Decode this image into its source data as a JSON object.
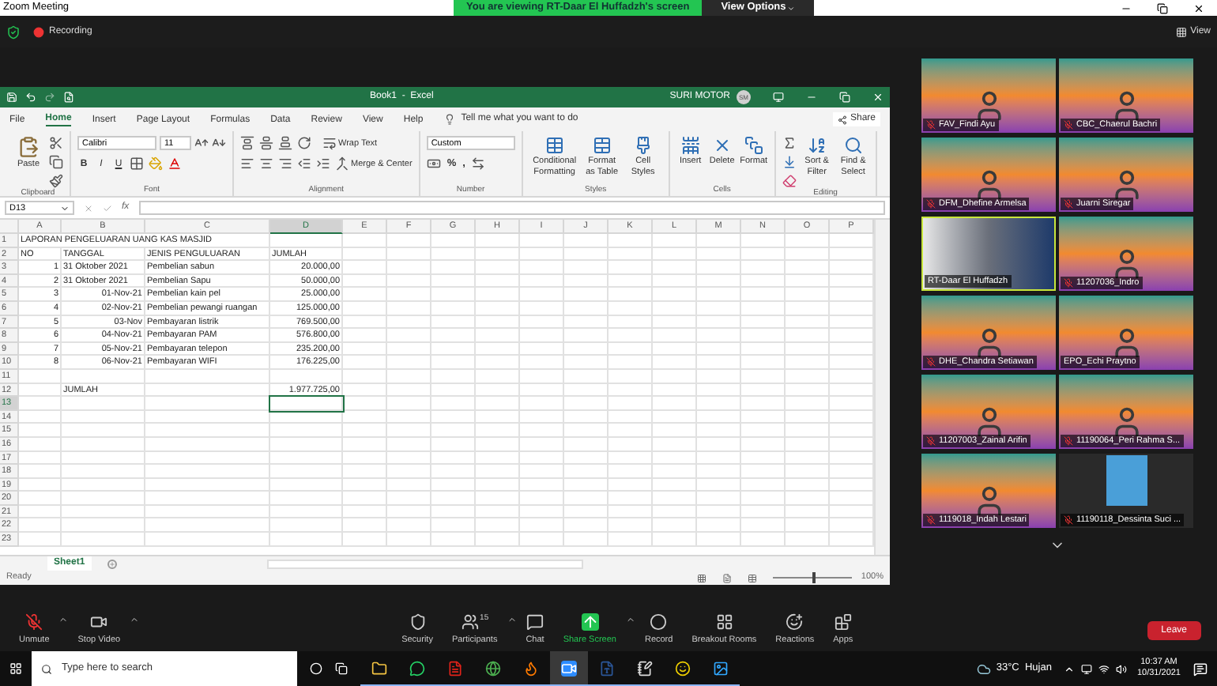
{
  "window": {
    "title": "Zoom Meeting",
    "screen_banner": "You are viewing RT-Daar El Huffadzh's screen",
    "view_options": "View Options"
  },
  "meeting_bar": {
    "recording": "Recording",
    "view": "View"
  },
  "excel": {
    "title": "Book1  -  Excel",
    "user": "SURI MOTOR",
    "user_initials": "SM",
    "tabs": [
      {
        "label": "File",
        "selected": false
      },
      {
        "label": "Home",
        "selected": true
      },
      {
        "label": "Insert",
        "selected": false
      },
      {
        "label": "Page Layout",
        "selected": false
      },
      {
        "label": "Formulas",
        "selected": false
      },
      {
        "label": "Data",
        "selected": false
      },
      {
        "label": "Review",
        "selected": false
      },
      {
        "label": "View",
        "selected": false
      },
      {
        "label": "Help",
        "selected": false
      }
    ],
    "tell_me": "Tell me what you want to do",
    "share": "Share",
    "ribbon_groups": [
      {
        "kind": "clipboard",
        "label": "Clipboard",
        "buttons": [
          "Paste"
        ]
      },
      {
        "kind": "font",
        "label": "Font",
        "font": "Calibri",
        "size": "11",
        "styles": [
          "B",
          "I",
          "U"
        ]
      },
      {
        "kind": "alignment",
        "label": "Alignment",
        "buttons": [
          "Wrap Text",
          "Merge & Center"
        ]
      },
      {
        "kind": "number",
        "label": "Number",
        "format": "Custom",
        "symbols": [
          "%",
          ","
        ]
      },
      {
        "kind": "styles",
        "label": "Styles",
        "buttons": [
          "Conditional Formatting",
          "Format as Table",
          "Cell Styles"
        ]
      },
      {
        "kind": "cells",
        "label": "Cells",
        "buttons": [
          "Insert",
          "Delete",
          "Format"
        ]
      },
      {
        "kind": "editing",
        "label": "Editing",
        "buttons": [
          "Sort & Filter",
          "Find & Select"
        ]
      }
    ],
    "name_box": "D13",
    "fx": "fx",
    "columns": [
      {
        "label": "A",
        "selected": false
      },
      {
        "label": "B",
        "selected": false
      },
      {
        "label": "C",
        "selected": false
      },
      {
        "label": "D",
        "selected": true
      },
      {
        "label": "E",
        "selected": false
      },
      {
        "label": "F",
        "selected": false
      },
      {
        "label": "G",
        "selected": false
      },
      {
        "label": "H",
        "selected": false
      },
      {
        "label": "I",
        "selected": false
      },
      {
        "label": "J",
        "selected": false
      },
      {
        "label": "K",
        "selected": false
      },
      {
        "label": "L",
        "selected": false
      },
      {
        "label": "M",
        "selected": false
      },
      {
        "label": "N",
        "selected": false
      },
      {
        "label": "O",
        "selected": false
      },
      {
        "label": "P",
        "selected": false
      }
    ],
    "rows": [
      {
        "number": "1",
        "kind": "title",
        "selected": false,
        "a": "LAPORAN PENGELUARAN UANG KAS MASJID"
      },
      {
        "number": "2",
        "kind": "header",
        "selected": false,
        "a": "NO",
        "b": "TANGGAL",
        "c": "JENIS PENGULUARAN",
        "d": "JUMLAH"
      },
      {
        "number": "3",
        "kind": "entry",
        "selected": false,
        "a": "1",
        "b": "31 Oktober 2021",
        "c": "Pembelian sabun",
        "d": "20.000,00"
      },
      {
        "number": "4",
        "kind": "entry",
        "selected": false,
        "a": "2",
        "b": "31 Oktober 2021",
        "c": "Pembelian Sapu",
        "d": "50.000,00"
      },
      {
        "number": "5",
        "kind": "dated_entry",
        "selected": false,
        "a": "3",
        "b": "01-Nov-21",
        "c": "Pembelian kain pel",
        "d": "25.000,00"
      },
      {
        "number": "6",
        "kind": "dated_entry",
        "selected": false,
        "a": "4",
        "b": "02-Nov-21",
        "c": "Pembelian pewangi ruangan",
        "d": "125.000,00"
      },
      {
        "number": "7",
        "kind": "dated_entry",
        "selected": false,
        "a": "5",
        "b": "03-Nov",
        "c": "Pembayaran listrik",
        "d": "769.500,00"
      },
      {
        "number": "8",
        "kind": "dated_entry",
        "selected": false,
        "a": "6",
        "b": "04-Nov-21",
        "c": "Pembayaran PAM",
        "d": "576.800,00"
      },
      {
        "number": "9",
        "kind": "dated_entry",
        "selected": false,
        "a": "7",
        "b": "05-Nov-21",
        "c": "Pembayaran telepon",
        "d": "235.200,00"
      },
      {
        "number": "10",
        "kind": "dated_entry",
        "selected": false,
        "a": "8",
        "b": "06-Nov-21",
        "c": "Pembayaran WIFI",
        "d": "176.225,00"
      },
      {
        "number": "11",
        "kind": "blank",
        "selected": false
      },
      {
        "number": "12",
        "kind": "total",
        "selected": false,
        "b": "JUMLAH",
        "d": "1.977.725,00"
      },
      {
        "number": "13",
        "kind": "blank",
        "selected": true
      },
      {
        "number": "14",
        "kind": "blank",
        "selected": false
      },
      {
        "number": "15",
        "kind": "blank",
        "selected": false
      },
      {
        "number": "16",
        "kind": "blank",
        "selected": false
      },
      {
        "number": "17",
        "kind": "blank",
        "selected": false
      },
      {
        "number": "18",
        "kind": "blank",
        "selected": false
      },
      {
        "number": "19",
        "kind": "blank",
        "selected": false
      },
      {
        "number": "20",
        "kind": "blank",
        "selected": false
      },
      {
        "number": "21",
        "kind": "blank",
        "selected": false
      },
      {
        "number": "22",
        "kind": "blank",
        "selected": false
      },
      {
        "number": "23",
        "kind": "blank",
        "selected": false
      }
    ],
    "sheet_tabs": [
      {
        "label": "Sheet1",
        "selected": true
      }
    ],
    "status": "Ready",
    "zoom_level": {
      "level": 0.5
    },
    "zoom_text": "100%"
  },
  "participants": [
    {
      "name": "FAV_Findi Ayu",
      "kind": "banner",
      "muted": true,
      "active": false
    },
    {
      "name": "CBC_Chaerul Bachri",
      "kind": "banner",
      "muted": true,
      "active": false
    },
    {
      "name": "DFM_Dhefine Armelsa",
      "kind": "banner",
      "muted": true,
      "active": false
    },
    {
      "name": "Juarni Siregar",
      "kind": "banner",
      "muted": true,
      "active": false
    },
    {
      "name": "RT-Daar El Huffadzh",
      "kind": "camera",
      "muted": false,
      "active": true
    },
    {
      "name": "11207036_Indro",
      "kind": "banner",
      "muted": true,
      "active": false
    },
    {
      "name": "DHE_Chandra Setiawan",
      "kind": "banner",
      "muted": true,
      "active": false
    },
    {
      "name": "EPO_Echi Praytno",
      "kind": "banner",
      "muted": false,
      "active": false
    },
    {
      "name": "11207003_Zainal Arifin",
      "kind": "banner",
      "muted": true,
      "active": false
    },
    {
      "name": "11190064_Peri Rahma S...",
      "kind": "banner",
      "muted": true,
      "active": false
    },
    {
      "name": "1119018_Indah Lestari",
      "kind": "banner",
      "muted": true,
      "active": false
    },
    {
      "name": "11190118_Dessinta Suci ...",
      "kind": "photo",
      "muted": true,
      "active": false
    }
  ],
  "toolbar": [
    {
      "label": "Unmute",
      "kind": "mic_off",
      "menu": true
    },
    {
      "label": "Stop Video",
      "kind": "video",
      "menu": true
    },
    {
      "label": "Security",
      "kind": "security",
      "menu": false
    },
    {
      "label": "Participants",
      "kind": "participants",
      "menu": true,
      "count": "15"
    },
    {
      "label": "Chat",
      "kind": "chat",
      "menu": false
    },
    {
      "label": "Share Screen",
      "kind": "share",
      "menu": true
    },
    {
      "label": "Record",
      "kind": "record",
      "menu": false
    },
    {
      "label": "Breakout Rooms",
      "kind": "breakout",
      "menu": false
    },
    {
      "label": "Reactions",
      "kind": "reactions",
      "menu": false
    },
    {
      "label": "Apps",
      "kind": "apps",
      "menu": false
    }
  ],
  "leave": "Leave",
  "taskbar": {
    "search_placeholder": "Type here to search",
    "apps": [
      {
        "kind": "folder",
        "active": false
      },
      {
        "kind": "chat",
        "active": false
      },
      {
        "kind": "pdf",
        "active": false
      },
      {
        "kind": "browser",
        "active": false
      },
      {
        "kind": "fox",
        "active": false
      },
      {
        "kind": "video",
        "active": true
      },
      {
        "kind": "document",
        "active": false
      },
      {
        "kind": "notepad",
        "active": false
      },
      {
        "kind": "emoji",
        "active": false
      },
      {
        "kind": "image",
        "active": false
      }
    ],
    "weather": "33°C  Hujan",
    "time": "10:37 AM",
    "date": "10/31/2021"
  }
}
